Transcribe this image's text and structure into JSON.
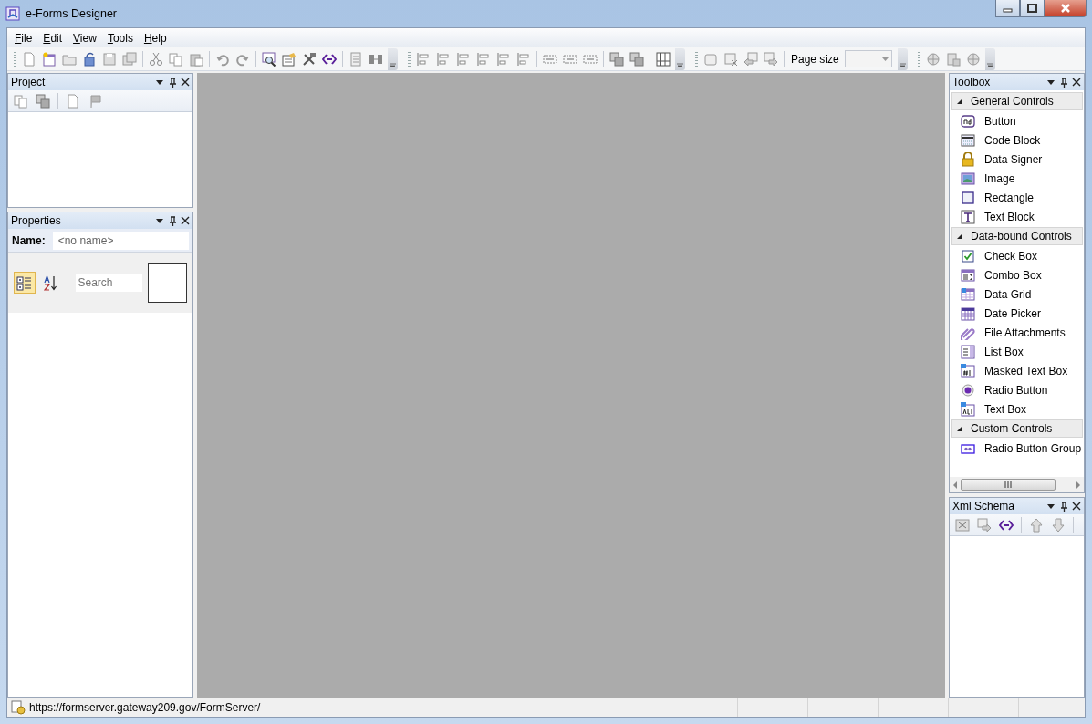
{
  "window": {
    "title": "e-Forms Designer"
  },
  "menu": [
    {
      "label": "File"
    },
    {
      "label": "Edit"
    },
    {
      "label": "View"
    },
    {
      "label": "Tools"
    },
    {
      "label": "Help"
    }
  ],
  "toolbar": {
    "page_size_label": "Page size"
  },
  "project_panel": {
    "title": "Project"
  },
  "properties_panel": {
    "title": "Properties",
    "name_label": "Name:",
    "name_placeholder": "<no name>",
    "search_placeholder": "Search",
    "sort_buttons": [
      {
        "kind": "categorized",
        "selected": true
      },
      {
        "kind": "alphabetical",
        "selected": false
      }
    ]
  },
  "toolbox": {
    "title": "Toolbox",
    "groups": [
      {
        "name": "General Controls",
        "expanded": true,
        "items": [
          {
            "label": "Button",
            "kind": "button"
          },
          {
            "label": "Code Block",
            "kind": "code"
          },
          {
            "label": "Data Signer",
            "kind": "lock"
          },
          {
            "label": "Image",
            "kind": "image"
          },
          {
            "label": "Rectangle",
            "kind": "rectangle"
          },
          {
            "label": "Text Block",
            "kind": "textblock"
          }
        ]
      },
      {
        "name": "Data-bound Controls",
        "expanded": true,
        "items": [
          {
            "label": "Check Box",
            "kind": "checkbox"
          },
          {
            "label": "Combo Box",
            "kind": "combo"
          },
          {
            "label": "Data Grid",
            "kind": "grid"
          },
          {
            "label": "Date Picker",
            "kind": "calendar"
          },
          {
            "label": "File Attachments",
            "kind": "paperclip"
          },
          {
            "label": "List Box",
            "kind": "list"
          },
          {
            "label": "Masked Text Box",
            "kind": "masked"
          },
          {
            "label": "Radio Button",
            "kind": "radio"
          },
          {
            "label": "Text Box",
            "kind": "textbox"
          }
        ]
      },
      {
        "name": "Custom Controls",
        "expanded": true,
        "items": [
          {
            "label": "Radio Button Group",
            "kind": "radiogroup"
          }
        ]
      }
    ]
  },
  "xml_schema_panel": {
    "title": "Xml Schema"
  },
  "status_bar": {
    "url": "https://formserver.gateway209.gov/FormServer/"
  }
}
